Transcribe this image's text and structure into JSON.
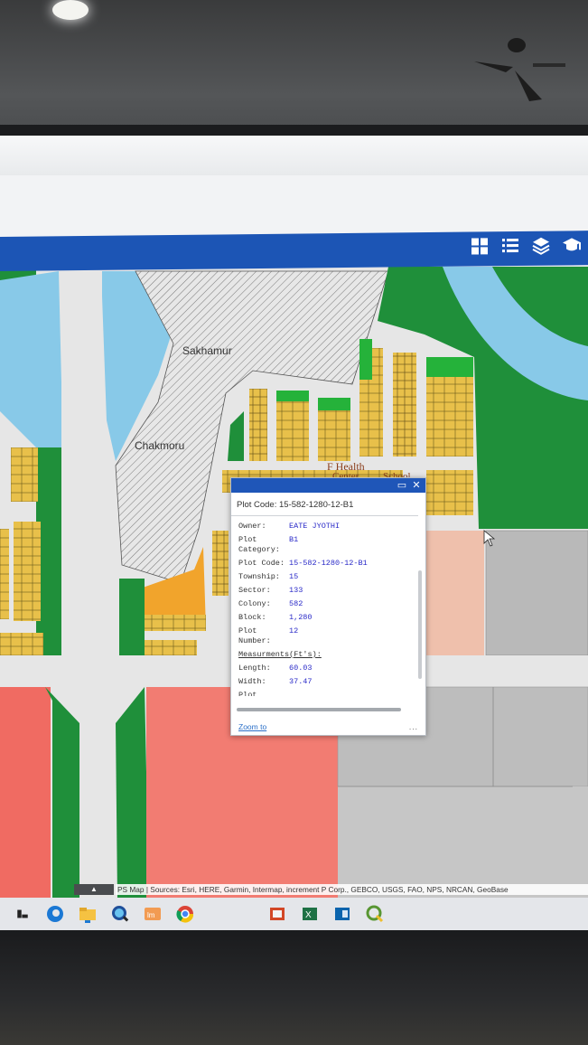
{
  "map": {
    "labels": [
      "Sakhamur",
      "Chakmoru",
      "F Health",
      "Center",
      "School"
    ]
  },
  "popup": {
    "title": "Plot Code: 15-582-1280-12-B1",
    "fields": [
      {
        "key": "Owner:",
        "value": "EATE JYOTHI"
      },
      {
        "key": "Plot Category:",
        "value": "B1"
      },
      {
        "key": "Plot Code:",
        "value": "15-582-1280-12-B1"
      },
      {
        "key": "Township:",
        "value": "15"
      },
      {
        "key": "Sector:",
        "value": "133"
      },
      {
        "key": "Colony:",
        "value": "582"
      },
      {
        "key": "Block:",
        "value": "1,280"
      },
      {
        "key": "Plot Number:",
        "value": "12"
      }
    ],
    "measurements_label": "Measurments(Ft's):",
    "measurements": [
      {
        "key": "Length:",
        "value": "60.03"
      },
      {
        "key": "Width:",
        "value": "37.47"
      }
    ],
    "truncated_key": "Plot",
    "zoom_label": "Zoom to",
    "more_label": "..."
  },
  "attribution": "PS Map | Sources: Esri, HERE, Garmin, Intermap, increment P Corp., GEBCO, USGS, FAO, NPS, NRCAN, GeoBase",
  "toolbar_icons": [
    "grid-icon",
    "list-icon",
    "layers-icon",
    "graduation-cap-icon"
  ],
  "taskbar_icons": [
    "start-icon",
    "edge-icon",
    "file-explorer-icon",
    "search-globe-icon",
    "mail-icon",
    "chrome-icon",
    "powerpoint-icon",
    "excel-icon",
    "outlook-icon",
    "qgis-icon"
  ],
  "colors": {
    "header": "#1c55b5",
    "green": "#1f8f3a",
    "water": "#88c9e8",
    "plot_yellow": "#e8c04a",
    "orange": "#f1a42c",
    "red_zone": "#f06b62",
    "pink_zone": "#f27c72",
    "grey_zone": "#bfbfbf"
  }
}
